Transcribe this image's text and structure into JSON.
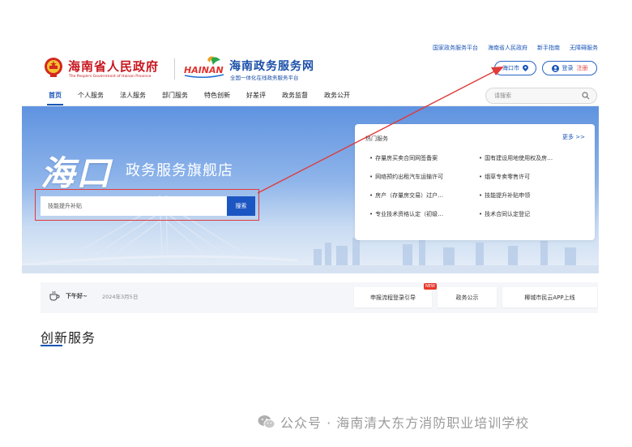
{
  "top_links": [
    "国家政务服务平台",
    "海南省人民政府",
    "新手指南",
    "无障碍服务"
  ],
  "logo": {
    "gov_name": "海南省人民政府",
    "gov_sub": "The People's Government of Hainan Province",
    "brand_mark": "HAINAN",
    "portal_name": "海南政务服务网",
    "portal_sub": "全国一体化在线政务服务平台"
  },
  "header": {
    "city": "海口市",
    "login": "登录",
    "register": "注册"
  },
  "nav": {
    "items": [
      "首页",
      "个人服务",
      "法人服务",
      "部门服务",
      "特色创新",
      "好差评",
      "政务监督",
      "政务公开"
    ],
    "active": "首页",
    "search_placeholder": "请搜索"
  },
  "hero": {
    "city_big": "海口",
    "title": "政务服务旗舰店",
    "search_value": "技能提升补贴",
    "search_button": "搜索"
  },
  "hot_services": {
    "title": "热门服务",
    "more": "更多 >>",
    "items": [
      "存量房买卖合同网签备案",
      "国有建设用地使用权及房…",
      "网络预约出租汽车运输许可",
      "烟草专卖零售许可",
      "房产（存量房交易）过户…",
      "技能提升补贴申领",
      "专业技术资格认定（初级…",
      "技术合同认定登记"
    ]
  },
  "info_bar": {
    "greeting": "下午好~",
    "date": "2024年3月5日",
    "buttons": [
      "申报流程登录引导",
      "政务公示",
      "椰城市民云APP上线"
    ],
    "new_badge": "NEW"
  },
  "section": {
    "title": "创新服务"
  },
  "watermark": {
    "text": "公众号 · 海南清大东方消防职业培训学校"
  },
  "colors": {
    "brand_blue": "#1a56b8",
    "gov_red": "#c8161e",
    "annotation_red": "#e03a3a"
  }
}
